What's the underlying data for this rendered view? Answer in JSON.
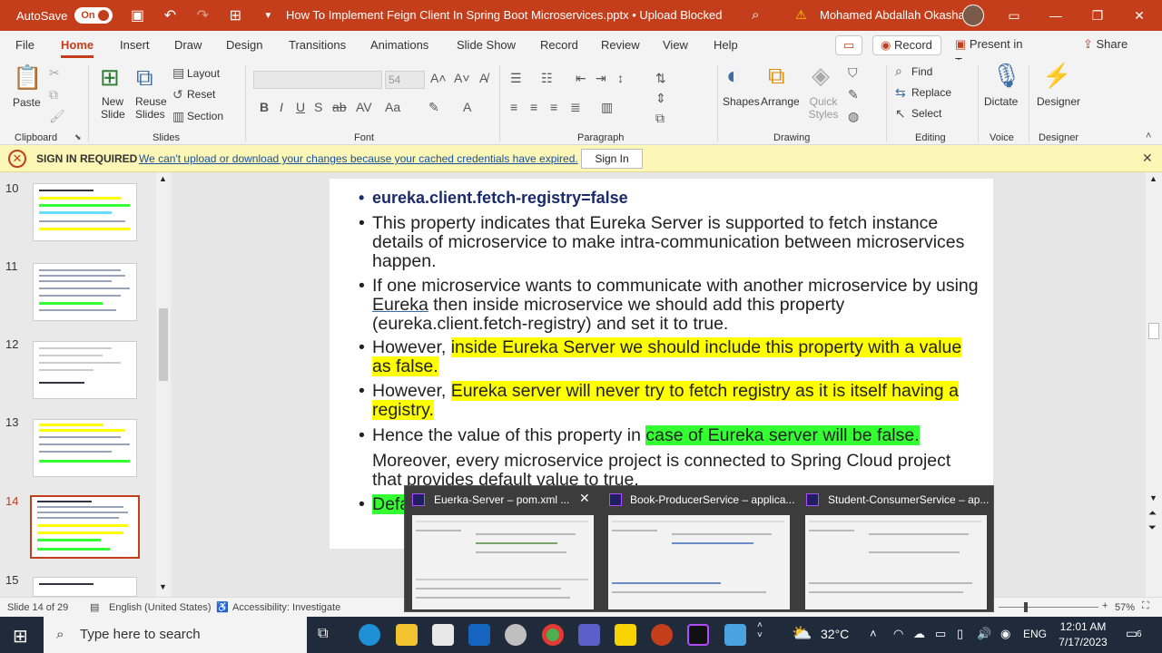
{
  "titlebar": {
    "autosave_label": "AutoSave",
    "autosave_state": "On",
    "document_title": "How To Implement Feign Client In Spring Boot Microservices.pptx • Upload Blocked",
    "user_name": "Mohamed Abdallah Okasha"
  },
  "menu": {
    "tabs": [
      "File",
      "Home",
      "Insert",
      "Draw",
      "Design",
      "Transitions",
      "Animations",
      "Slide Show",
      "Record",
      "Review",
      "View",
      "Help"
    ],
    "active_tab": "Home",
    "record_button": "Record",
    "present_in_teams": "Present in Teams",
    "share": "Share"
  },
  "ribbon": {
    "paste": "Paste",
    "new_slide": "New Slide",
    "reuse_slides": "Reuse Slides",
    "layout": "Layout",
    "reset": "Reset",
    "section": "Section",
    "font_size": "54",
    "shapes": "Shapes",
    "arrange": "Arrange",
    "quick_styles": "Quick Styles",
    "find": "Find",
    "replace": "Replace",
    "select": "Select",
    "dictate": "Dictate",
    "designer": "Designer",
    "groups": {
      "clipboard": "Clipboard",
      "slides": "Slides",
      "font": "Font",
      "paragraph": "Paragraph",
      "drawing": "Drawing",
      "editing": "Editing",
      "voice": "Voice",
      "designer": "Designer"
    }
  },
  "message_bar": {
    "title": "SIGN IN REQUIRED",
    "message": "We can't upload or download your changes because your cached credentials have expired.",
    "button": "Sign In"
  },
  "thumbnails": {
    "numbers": [
      "10",
      "11",
      "12",
      "13",
      "14",
      "15"
    ],
    "selected": "14"
  },
  "slide": {
    "heading": "eureka.client.fetch-registry=false",
    "b1": "This property indicates that Eureka Server is supported to fetch instance details of microservice to make intra-communication between microservices happen.",
    "b2a": "If one microservice wants to communicate with another microservice by using ",
    "b2b": "Eureka",
    "b2c": " then inside microservice we should add this property (eureka.client.fetch-registry) and set it to true.",
    "b3a": "However, ",
    "b3b": "inside Eureka Server we should include this property with a value as false.",
    "b4a": "However, ",
    "b4b": "Eureka server will never try to fetch registry as it is itself having a registry.",
    "b5a": "Hence the value of this property in ",
    "b5b": "case of Eureka server will be false.",
    "b6": "Moreover, every microservice project is connected to Spring Cloud project that provides default value to true.",
    "b7": "Defa"
  },
  "taskbar_popup": {
    "windows": [
      "Euerka-Server – pom.xml ...",
      "Book-ProducerService – applica...",
      "Student-ConsumerService – ap..."
    ]
  },
  "statusbar": {
    "slide_info": "Slide 14 of 29",
    "language": "English (United States)",
    "accessibility": "Accessibility: Investigate",
    "zoom": "57%"
  },
  "taskbar": {
    "search_placeholder": "Type here to search",
    "temperature": "32°C",
    "language": "ENG",
    "time": "12:01 AM",
    "date": "7/17/2023",
    "notifications": "6"
  }
}
